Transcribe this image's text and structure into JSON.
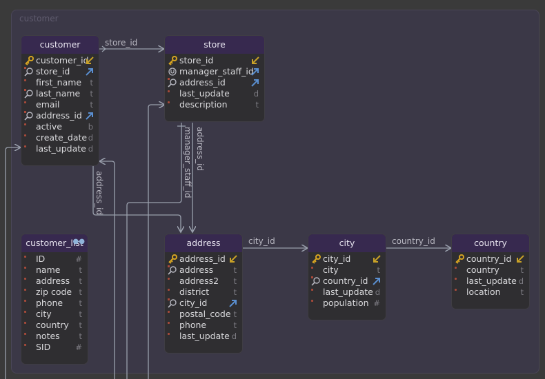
{
  "group": {
    "title": "customer"
  },
  "tables": {
    "customer": {
      "title": "customer",
      "rows": [
        {
          "name": "customer_id",
          "kind": "pk",
          "ref": "down"
        },
        {
          "name": "store_id",
          "kind": "fk",
          "ref": "up"
        },
        {
          "name": "first_name",
          "kind": "col",
          "type": "t"
        },
        {
          "name": "last_name",
          "kind": "fk",
          "type": "t"
        },
        {
          "name": "email",
          "kind": "col",
          "type": "t"
        },
        {
          "name": "address_id",
          "kind": "fk",
          "ref": "up"
        },
        {
          "name": "active",
          "kind": "col",
          "type": "b"
        },
        {
          "name": "create_date",
          "kind": "col",
          "type": "d"
        },
        {
          "name": "last_update",
          "kind": "col",
          "type": "d"
        }
      ]
    },
    "store": {
      "title": "store",
      "rows": [
        {
          "name": "store_id",
          "kind": "pk",
          "ref": "down"
        },
        {
          "name": "manager_staff_id",
          "kind": "uk",
          "ref": "up"
        },
        {
          "name": "address_id",
          "kind": "fk",
          "ref": "up"
        },
        {
          "name": "last_update",
          "kind": "col",
          "type": "d"
        },
        {
          "name": "description",
          "kind": "col",
          "type": "t"
        }
      ]
    },
    "customer_list": {
      "title": "customer_list",
      "badge": "view-icon",
      "rows": [
        {
          "name": "ID",
          "kind": "col",
          "type": "#"
        },
        {
          "name": "name",
          "kind": "col",
          "type": "t"
        },
        {
          "name": "address",
          "kind": "col",
          "type": "t"
        },
        {
          "name": "zip code",
          "kind": "col",
          "type": "t"
        },
        {
          "name": "phone",
          "kind": "col",
          "type": "t"
        },
        {
          "name": "city",
          "kind": "col",
          "type": "t"
        },
        {
          "name": "country",
          "kind": "col",
          "type": "t"
        },
        {
          "name": "notes",
          "kind": "col",
          "type": "t"
        },
        {
          "name": "SID",
          "kind": "col",
          "type": "#"
        }
      ]
    },
    "address": {
      "title": "address",
      "rows": [
        {
          "name": "address_id",
          "kind": "pk",
          "ref": "down"
        },
        {
          "name": "address",
          "kind": "fk",
          "type": "t"
        },
        {
          "name": "address2",
          "kind": "col",
          "type": "t"
        },
        {
          "name": "district",
          "kind": "col",
          "type": "t"
        },
        {
          "name": "city_id",
          "kind": "fk",
          "ref": "up"
        },
        {
          "name": "postal_code",
          "kind": "col",
          "type": "t"
        },
        {
          "name": "phone",
          "kind": "col",
          "type": "t"
        },
        {
          "name": "last_update",
          "kind": "col",
          "type": "d"
        }
      ]
    },
    "city": {
      "title": "city",
      "rows": [
        {
          "name": "city_id",
          "kind": "pk",
          "ref": "down"
        },
        {
          "name": "city",
          "kind": "col",
          "type": "t"
        },
        {
          "name": "country_id",
          "kind": "fk",
          "ref": "up"
        },
        {
          "name": "last_update",
          "kind": "col",
          "type": "d"
        },
        {
          "name": "population",
          "kind": "col",
          "type": "#"
        }
      ]
    },
    "country": {
      "title": "country",
      "rows": [
        {
          "name": "country_id",
          "kind": "pk",
          "ref": "down"
        },
        {
          "name": "country",
          "kind": "col",
          "type": "t"
        },
        {
          "name": "last_update",
          "kind": "col",
          "type": "d"
        },
        {
          "name": "location",
          "kind": "col",
          "type": "t"
        }
      ]
    }
  },
  "links": {
    "store_id": "store_id",
    "address_id_customer": "address_id",
    "address_id_store": "address_id",
    "manager_staff_id": "manager_staff_id",
    "city_id": "city_id",
    "country_id": "country_id"
  },
  "colors": {
    "pk": "#d8a521",
    "ref_down": "#c9a227",
    "ref_up": "#5a8fd1",
    "line": "#9aa0ad"
  }
}
